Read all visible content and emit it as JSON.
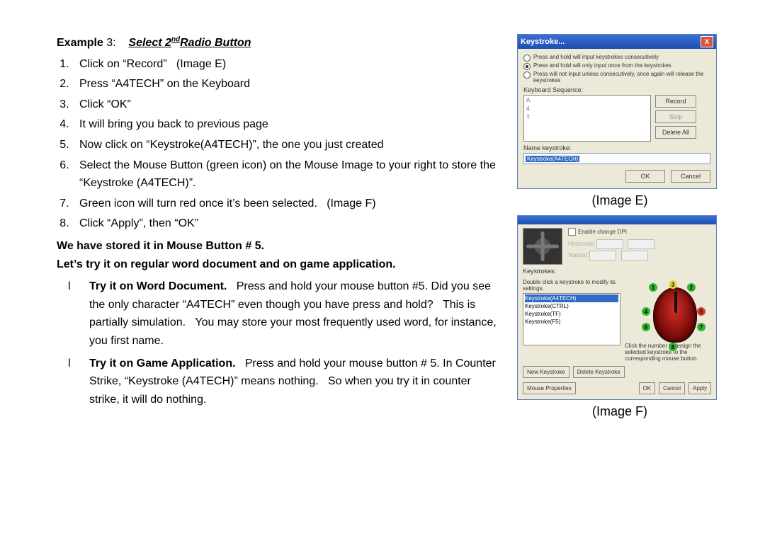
{
  "doc": {
    "example_label": "Example",
    "example_num": "3",
    "colon": ":",
    "title_pre": "Select 2",
    "title_sup": "nd",
    "title_post": "Radio Button",
    "steps": [
      "Click on “Record”   (Image E)",
      "Press “A4TECH” on the Keyboard",
      "Click “OK”",
      "It will bring you back to previous page",
      "Now click on “Keystroke(A4TECH)”, the one you just created",
      "Select the Mouse Button (green icon) on the Mouse Image to your right to store the “Keystroke (A4TECH)”.",
      "Green icon will turn red once it’s been selected.   (Image F)",
      "Click “Apply”, then “OK”"
    ],
    "stored": "We have stored it in Mouse Button # 5.",
    "try_line": "Let’s try it on regular word document and on game application.",
    "bullets": [
      {
        "lead": "Try it on Word Document.",
        "body": "   Press and hold your mouse button #5. Did you see the only character “A4TECH” even though you have press and hold?   This is partially simulation.   You may store your most frequently used word, for instance, you first name."
      },
      {
        "lead": "Try it on Game Application.",
        "body": "   Press and hold your mouse button # 5. In Counter Strike, “Keystroke (A4TECH)” means nothing.   So when you try it in counter strike, it will do nothing."
      }
    ],
    "caption_e": "(Image E)",
    "caption_f": "(Image F)"
  },
  "dlgE": {
    "title": "Keystroke...",
    "radio1": "Press and hold will input keystrokes consecutively",
    "radio2": "Press and hold will only input once from the keystrokes",
    "radio3": "Press will not input unless consecutively, once again will release the keystrokes",
    "seq_label": "Keyboard Sequence:",
    "seq_rows": [
      "A",
      "4",
      "T"
    ],
    "btns": {
      "rec": "Record",
      "stop": "Stop",
      "del": "Delete All"
    },
    "name_label": "Name keystroke:",
    "name_value": "Keystroke(A4TECH)",
    "ok": "OK",
    "cancel": "Cancel"
  },
  "dlgF": {
    "enable": "Enable change DPI",
    "res_h": "Horizontal:",
    "res_v": "Vertical:",
    "ks_label": "Keystrokes:",
    "ks_hint": "Double click a keystroke to modify its settings.",
    "ks_items": [
      "Keystroke(A4TECH)",
      "Keystroke(CTRL)",
      "Keystroke(TF)",
      "Keystroke(F5)"
    ],
    "mouse_hint": "Click the number to assign the selected keystroke to the corresponding mouse button.",
    "btn_new": "New Keystroke",
    "btn_del": "Delete Keystroke",
    "btn_prop": "Mouse Properties",
    "ok": "OK",
    "cancel": "Cancel",
    "apply": "Apply"
  }
}
